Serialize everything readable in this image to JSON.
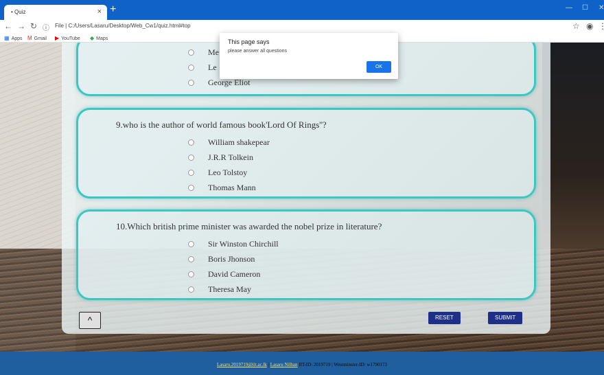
{
  "browser": {
    "tab_title": "Quiz",
    "tab_close": "×",
    "new_tab": "+",
    "url_prefix": "File",
    "url": "C:/Users/Lasaru/Desktop/Web_Cw1/quiz.html#top",
    "bookmarks": [
      "Apps",
      "Gmail",
      "YouTube",
      "Maps"
    ]
  },
  "alert": {
    "title": "This page says",
    "message": "please answer all questions",
    "ok_label": "OK"
  },
  "questions": [
    {
      "text": "",
      "options": [
        "Me",
        "Le",
        "George Eliot"
      ]
    },
    {
      "text": "9.who is the author of world famous book'Lord Of Rings''?",
      "options": [
        "William shakepear",
        "J.R.R Tolkein",
        "Leo Tolstoy",
        "Thomas Mann"
      ]
    },
    {
      "text": "10.Which british prime minister was awarded the nobel prize in literature?",
      "options": [
        "Sir Winston Chirchill",
        "Boris Jhonson",
        "David Cameron",
        "Theresa May"
      ]
    }
  ],
  "buttons": {
    "scroll_top": "^",
    "reset": "RESET",
    "submit": "SUBMIT"
  },
  "footer": {
    "email": "Lasaru.2019719@iit.ac.lk",
    "name": "Lasaru Nilhan",
    "ids": "IIT-ID: 2019719 | Westminster-ID: w1790173"
  }
}
